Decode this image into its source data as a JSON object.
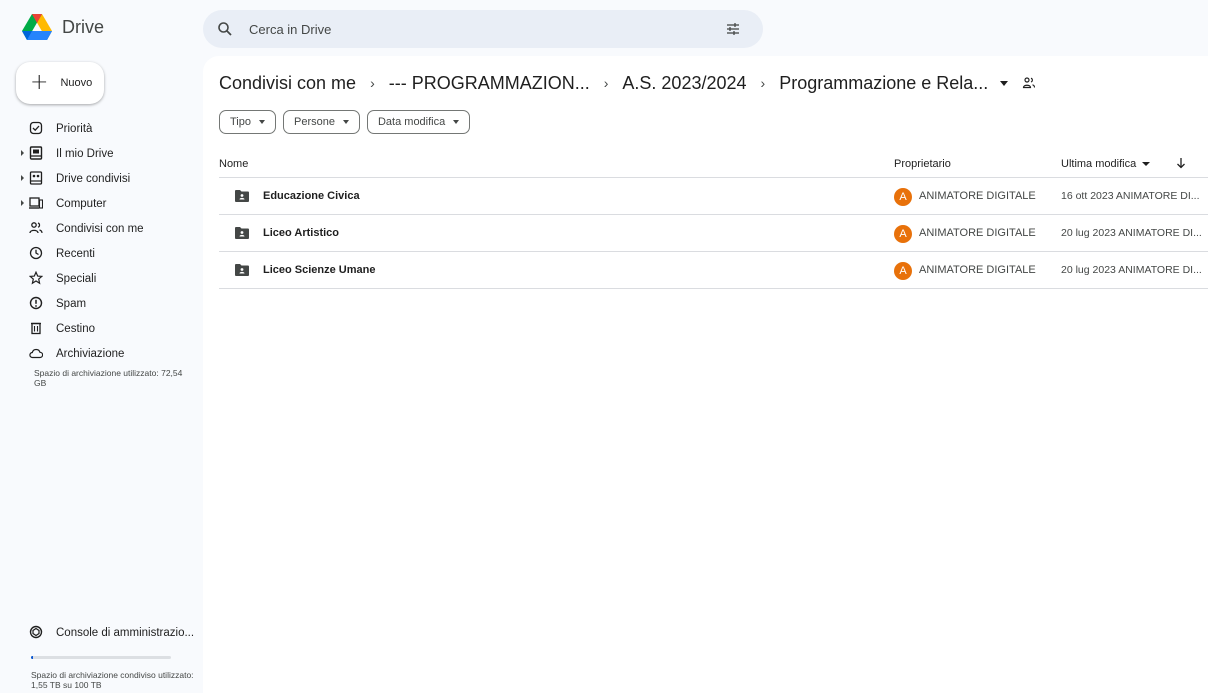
{
  "app": {
    "name": "Drive"
  },
  "search": {
    "placeholder": "Cerca in Drive"
  },
  "sidebar": {
    "new_label": "Nuovo",
    "items": [
      {
        "label": "Priorità",
        "icon": "check-circle-icon",
        "expandable": false
      },
      {
        "label": "Il mio Drive",
        "icon": "my-drive-icon",
        "expandable": true
      },
      {
        "label": "Drive condivisi",
        "icon": "shared-drives-icon",
        "expandable": true
      },
      {
        "label": "Computer",
        "icon": "computer-icon",
        "expandable": true
      },
      {
        "label": "Condivisi con me",
        "icon": "people-icon",
        "expandable": false
      },
      {
        "label": "Recenti",
        "icon": "clock-icon",
        "expandable": false
      },
      {
        "label": "Speciali",
        "icon": "star-icon",
        "expandable": false
      },
      {
        "label": "Spam",
        "icon": "spam-icon",
        "expandable": false
      },
      {
        "label": "Cestino",
        "icon": "trash-icon",
        "expandable": false
      },
      {
        "label": "Archiviazione",
        "icon": "cloud-icon",
        "expandable": false
      }
    ],
    "storage_text": "Spazio di archiviazione utilizzato: 72,54 GB",
    "console_label": "Console di amministrazio...",
    "shared_storage_fraction": 0.0155,
    "shared_storage_text": "Spazio di archiviazione condiviso utilizzato: 1,55 TB su 100 TB"
  },
  "breadcrumb": {
    "items": [
      "Condivisi con me",
      "--- PROGRAMMAZION...",
      "A.S. 2023/2024",
      "Programmazione e Rela..."
    ],
    "separator": "›"
  },
  "filters": [
    "Tipo",
    "Persone",
    "Data modifica"
  ],
  "table": {
    "columns": {
      "name": "Nome",
      "owner": "Proprietario",
      "modified": "Ultima modifica"
    },
    "rows": [
      {
        "name": "Educazione Civica",
        "owner_initial": "A",
        "owner": "ANIMATORE DIGITALE",
        "modified": "16 ott 2023 ANIMATORE DI..."
      },
      {
        "name": "Liceo Artistico",
        "owner_initial": "A",
        "owner": "ANIMATORE DIGITALE",
        "modified": "20 lug 2023 ANIMATORE DI..."
      },
      {
        "name": "Liceo Scienze Umane",
        "owner_initial": "A",
        "owner": "ANIMATORE DIGITALE",
        "modified": "20 lug 2023 ANIMATORE DI..."
      }
    ]
  },
  "colors": {
    "background": "#f8fafd",
    "search_bg": "#e9eef6",
    "avatar": "#e8710a",
    "accent": "#0b57d0"
  }
}
